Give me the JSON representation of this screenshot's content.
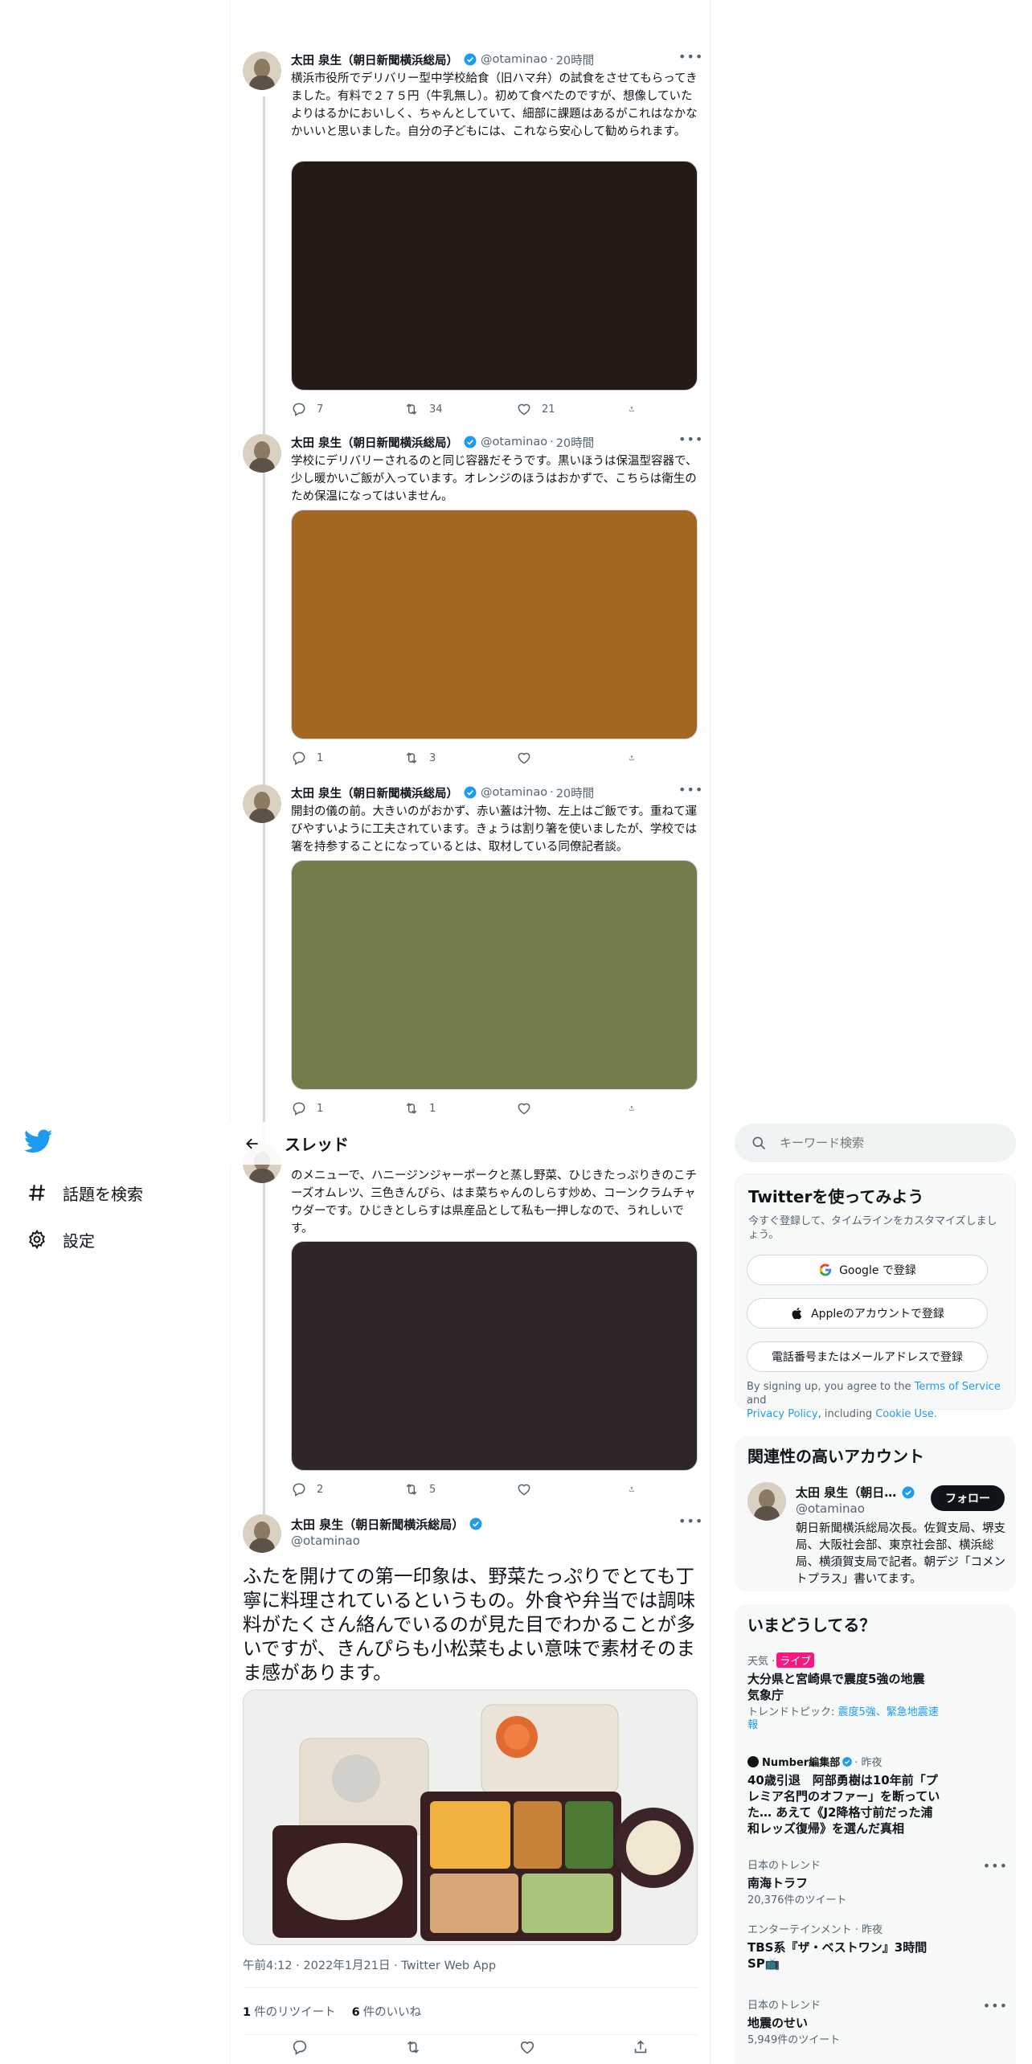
{
  "nav": {
    "explore": "話題を検索",
    "settings": "設定"
  },
  "header": {
    "title": "スレッド"
  },
  "author": {
    "name": "太田 泉生（朝日新聞横浜総局）",
    "handle": "@otaminao",
    "time": "20時間"
  },
  "thread": [
    {
      "text": "横浜市役所でデリバリー型中学校給食（旧ハマ弁）の試食をさせてもらってきました。有料で２７５円（牛乳無し）。初めて食べたのですが、想像していたよりはるかにおいしく、ちゃんとしていて、細部に課題はあるがこれはなかなかいいと思いました。自分の子どもには、これなら安心して勧められます。",
      "media_color": "#261a17",
      "replies": "7",
      "retweets": "34",
      "likes": "21"
    },
    {
      "text": "学校にデリバリーされるのと同じ容器だそうです。黒いほうは保温型容器で、少し暖かいご飯が入っています。オレンジのほうはおかずで、こちらは衛生のため保温になってはいません。",
      "media_color": "#a46723",
      "replies": "1",
      "retweets": "3",
      "likes": ""
    },
    {
      "text": "開封の儀の前。大きいのがおかず、赤い蓋は汁物、左上はご飯です。重ねて運びやすいように工夫されています。きょうは割り箸を使いましたが、学校では箸を持参することになっているとは、取材している同僚記者談。",
      "media_color": "#757c4c",
      "replies": "1",
      "retweets": "1",
      "likes": ""
    },
    {
      "text": "のメニューで、ハニージンジャーポークと蒸し野菜、ひじきたっぷりきのこチーズオムレツ、三色きんぴら、はま菜ちゃんのしらす炒め、コーンクラムチャウダーです。ひじきとしらすは県産品として私も一押しなので、うれしいです。",
      "media_color": "#302629",
      "replies": "2",
      "retweets": "5",
      "likes": ""
    }
  ],
  "main_tweet": {
    "text": "ふたを開けての第一印象は、野菜たっぷりでとても丁寧に料理されているというもの。外食や弁当では調味料がたくさん絡んでいるのが見た目でわかることが多いですが、きんぴらも小松菜もよい意味で素材そのまま感があります。",
    "meta": "午前4:12 · 2022年1月21日 · Twitter Web App",
    "retweet_count": "1",
    "retweet_label": "件のリツイート",
    "like_count": "6",
    "like_label": "件のいいね"
  },
  "search": {
    "placeholder": "キーワード検索"
  },
  "signup": {
    "title": "Twitterを使ってみよう",
    "subtitle": "今すぐ登録して、タイムラインをカスタマイズしましょう。",
    "google": "Google で登録",
    "apple": "Appleのアカウントで登録",
    "phone": "電話番号またはメールアドレスで登録",
    "legal_prefix": "By signing up, you agree to the",
    "terms": "Terms of Service",
    "and": "and",
    "privacy": "Privacy Policy",
    "including": ", including",
    "cookie": "Cookie Use."
  },
  "related": {
    "title": "関連性の高いアカウント",
    "name": "太田 泉生（朝日…",
    "handle": "@otaminao",
    "follow": "フォロー",
    "bio": "朝日新聞横浜総局次長。佐賀支局、堺支局、大阪社会部、東京社会部、横浜総局、横須賀支局で記者。朝デジ「コメントプラス」書いてます。"
  },
  "trends": {
    "title": "いまどうしてる？",
    "items": [
      {
        "meta": "天気 · ",
        "live": "ライブ",
        "title": "大分県と宮崎県で震度5強の地震 気象庁",
        "sub_prefix": "トレンドトピック: ",
        "sub_link": "震度5強、緊急地震速報"
      },
      {
        "source": "Number編集部",
        "meta": " · 昨夜",
        "title": "40歳引退　阿部勇樹は10年前「プレミア名門のオファー」を断っていた… あえて《J2降格寸前だった浦和レッズ復帰》を選んだ真相"
      },
      {
        "meta": "日本のトレンド",
        "title": "南海トラフ",
        "sub": "20,376件のツイート"
      },
      {
        "meta": "エンターテインメント · 昨夜",
        "title": "TBS系『ザ・ベストワン』3時間SP📺"
      },
      {
        "meta": "日本のトレンド",
        "title": "地震のせい",
        "sub": "5,949件のツイート"
      }
    ]
  },
  "colors": {
    "accent": "#1d9bf0",
    "text": "#0f1419",
    "muted": "#536471",
    "live": "#f91880"
  }
}
